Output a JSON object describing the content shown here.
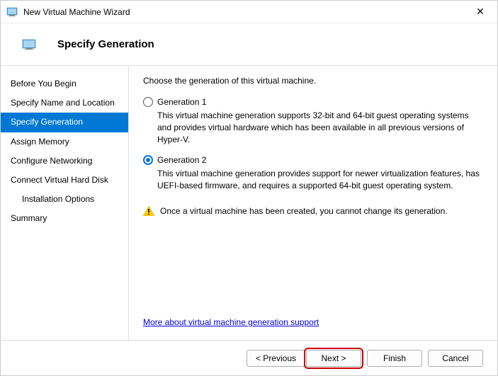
{
  "window": {
    "title": "New Virtual Machine Wizard"
  },
  "header": {
    "title": "Specify Generation"
  },
  "sidebar": {
    "items": [
      {
        "label": "Before You Begin"
      },
      {
        "label": "Specify Name and Location"
      },
      {
        "label": "Specify Generation"
      },
      {
        "label": "Assign Memory"
      },
      {
        "label": "Configure Networking"
      },
      {
        "label": "Connect Virtual Hard Disk"
      },
      {
        "label": "Installation Options"
      },
      {
        "label": "Summary"
      }
    ]
  },
  "content": {
    "intro": "Choose the generation of this virtual machine.",
    "gen1": {
      "label": "Generation 1",
      "desc": "This virtual machine generation supports 32-bit and 64-bit guest operating systems and provides virtual hardware which has been available in all previous versions of Hyper-V."
    },
    "gen2": {
      "label": "Generation 2",
      "desc": "This virtual machine generation provides support for newer virtualization features, has UEFI-based firmware, and requires a supported 64-bit guest operating system."
    },
    "warning": "Once a virtual machine has been created, you cannot change its generation.",
    "link": "More about virtual machine generation support"
  },
  "footer": {
    "previous": "< Previous",
    "next": "Next >",
    "finish": "Finish",
    "cancel": "Cancel"
  }
}
